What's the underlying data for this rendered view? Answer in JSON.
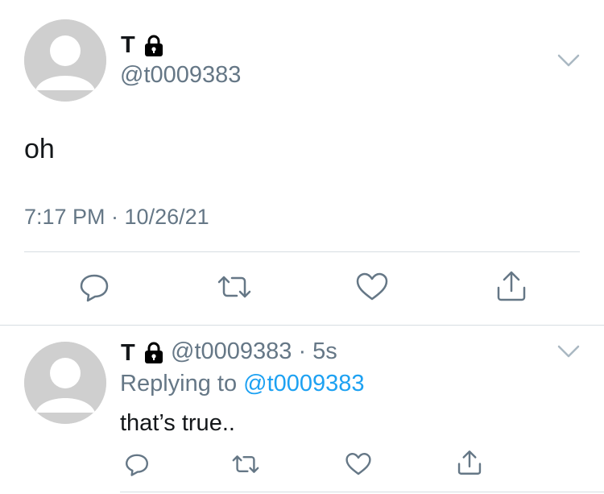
{
  "main_tweet": {
    "display_name": "T",
    "handle": "@t0009383",
    "text": "oh",
    "timestamp": "7:17 PM · 10/26/21",
    "icons": {
      "lock": "lock-icon",
      "menu": "chevron-down-icon",
      "reply": "reply-icon",
      "retweet": "retweet-icon",
      "like": "heart-icon",
      "share": "share-icon"
    }
  },
  "reply_tweet": {
    "display_name": "T",
    "handle_and_time": "@t0009383 · 5s",
    "replying_prefix": "Replying to",
    "replying_to": "@t0009383",
    "text": "that’s true.."
  },
  "colors": {
    "text_primary": "#14171a",
    "text_secondary": "#657786",
    "link": "#1da1f2",
    "divider": "#d7dde2",
    "avatar_bg": "#cfcfcf",
    "icon_stroke": "#657786"
  }
}
